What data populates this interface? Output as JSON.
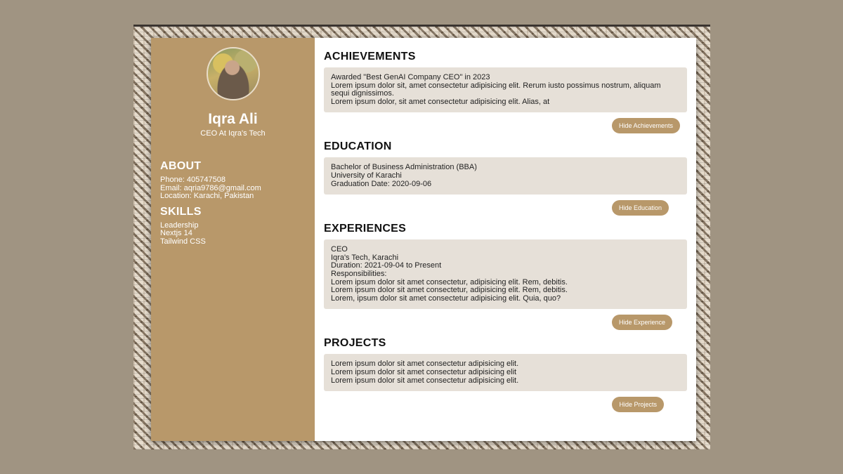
{
  "profile": {
    "name": "Iqra Ali",
    "role": "CEO At Iqra's Tech"
  },
  "about": {
    "heading": "ABOUT",
    "lines": [
      "Phone: 405747508",
      "Email: aqria9786@gmail.com",
      "Location: Karachi, Pakistan"
    ]
  },
  "skills": {
    "heading": "SKILLS",
    "items": [
      "Leadership",
      "Nextjs 14",
      "Tailwind CSS"
    ]
  },
  "achievements": {
    "heading": "ACHIEVEMENTS",
    "lines": [
      "Awarded \"Best GenAI Company CEO\" in 2023",
      "Lorem ipsum dolor sit, amet consectetur adipisicing elit. Rerum iusto possimus nostrum, aliquam sequi dignissimos.",
      "Lorem ipsum dolor, sit amet consectetur adipisicing elit. Alias, at"
    ],
    "button": "Hide Achievements"
  },
  "education": {
    "heading": "EDUCATION",
    "lines": [
      "Bachelor of Business Administration (BBA)",
      "University of Karachi",
      "Graduation Date: 2020-09-06"
    ],
    "button": "Hide Education"
  },
  "experiences": {
    "heading": "EXPERIENCES",
    "lines": [
      "CEO",
      "Iqra's Tech, Karachi",
      "Duration: 2021-09-04 to Present",
      "Responsibilities:",
      "Lorem ipsum dolor sit amet consectetur, adipisicing elit. Rem, debitis.",
      "Lorem ipsum dolor sit amet consectetur, adipisicing elit. Rem, debitis.",
      "Lorem, ipsum dolor sit amet consectetur adipisicing elit. Quia, quo?"
    ],
    "button": "Hide Experience"
  },
  "projects": {
    "heading": "PROJECTS",
    "lines": [
      "Lorem ipsum dolor sit amet consectetur adipisicing elit.",
      "Lorem ipsum dolor sit amet consectetur adipisicing elit",
      "Lorem ipsum dolor sit amet consectetur adipisicing elit."
    ],
    "button": "Hide Projects"
  },
  "colors": {
    "accent": "#b8986a",
    "box_bg": "#e6e0d8",
    "page_bg": "#a09482"
  }
}
